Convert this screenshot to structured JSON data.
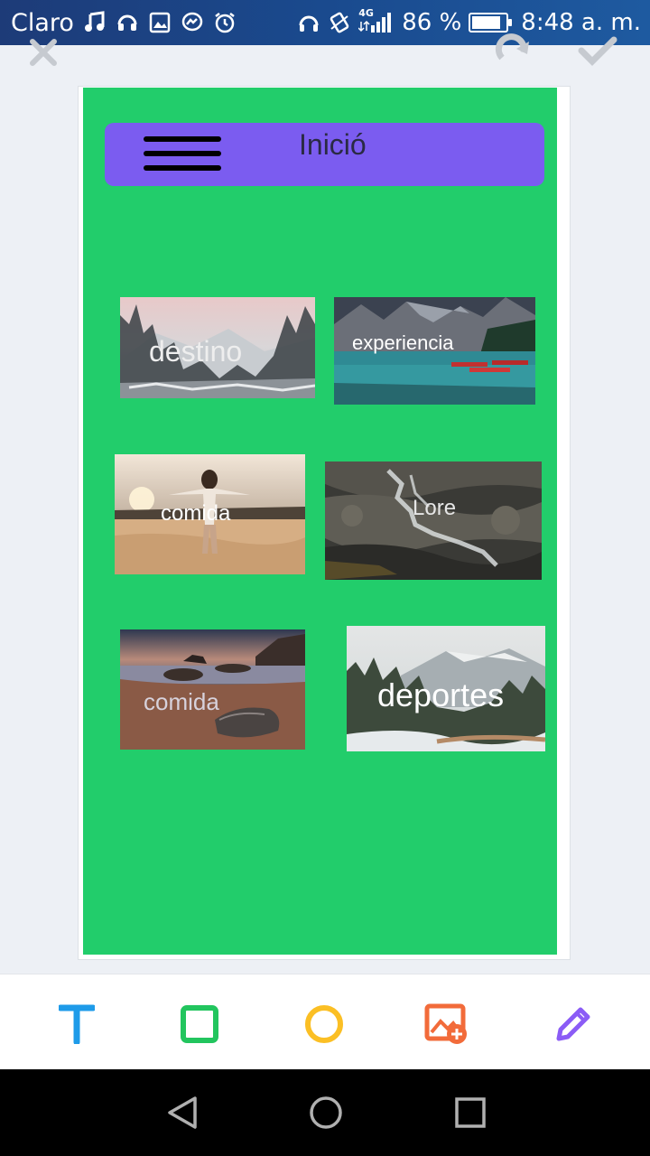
{
  "status_bar": {
    "carrier": "Claro",
    "left_icons": [
      "music-note-icon",
      "headset-icon",
      "image-icon",
      "messenger-icon",
      "alarm-icon"
    ],
    "right_icons": [
      "headphones-icon",
      "vibrate-icon",
      "signal-4g-icon"
    ],
    "network": "4G",
    "battery": "86 %",
    "battery_level": 0.86,
    "time": "8:48 a. m."
  },
  "editor": {
    "top_icons": [
      "close-icon",
      "redo-icon",
      "check-icon"
    ],
    "toolbar": [
      {
        "name": "text-tool",
        "icon": "T",
        "color": "#1e9be9"
      },
      {
        "name": "rectangle-tool",
        "icon": "rectangle",
        "color": "#22c55e"
      },
      {
        "name": "circle-tool",
        "icon": "circle",
        "color": "#fbbf24"
      },
      {
        "name": "add-image-tool",
        "icon": "image-plus",
        "color": "#f26b3a"
      },
      {
        "name": "pen-tool",
        "icon": "pencil",
        "color": "#8b5cf6"
      }
    ]
  },
  "mockup": {
    "background_color": "#22cd6b",
    "header_color": "#7b5cf0",
    "header_title": "Inició",
    "tiles": [
      {
        "label": "destino",
        "scene": "snowy-forest"
      },
      {
        "label": "experiencia",
        "scene": "mountain-lake"
      },
      {
        "label": "comida",
        "scene": "beach-sunset-person"
      },
      {
        "label": "Lore",
        "scene": "waterfall-rocks"
      },
      {
        "label": "comida",
        "scene": "rocky-beach-dusk"
      },
      {
        "label": "deportes",
        "scene": "snowy-mountain-trees"
      }
    ]
  },
  "nav_bar": {
    "buttons": [
      "back-icon",
      "home-icon",
      "recents-icon"
    ]
  }
}
